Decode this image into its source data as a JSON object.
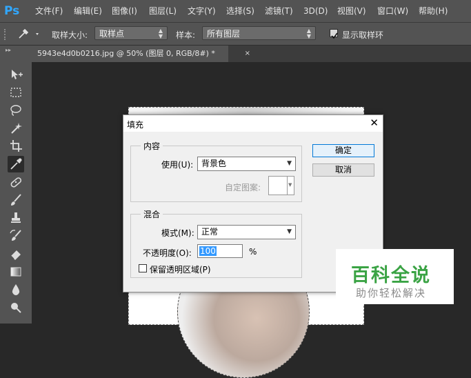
{
  "app": {
    "logo": "Ps"
  },
  "menu": [
    {
      "id": "file",
      "label": "文件(F)"
    },
    {
      "id": "edit",
      "label": "编辑(E)"
    },
    {
      "id": "image",
      "label": "图像(I)"
    },
    {
      "id": "layer",
      "label": "图层(L)"
    },
    {
      "id": "type",
      "label": "文字(Y)"
    },
    {
      "id": "select",
      "label": "选择(S)"
    },
    {
      "id": "filter",
      "label": "滤镜(T)"
    },
    {
      "id": "3d",
      "label": "3D(D)"
    },
    {
      "id": "view",
      "label": "视图(V)"
    },
    {
      "id": "window",
      "label": "窗口(W)"
    },
    {
      "id": "help",
      "label": "帮助(H)"
    }
  ],
  "options": {
    "sample_size_label": "取样大小:",
    "sample_size_value": "取样点",
    "sample_label": "样本:",
    "sample_value": "所有图层",
    "show_ring_label": "显示取样环",
    "show_ring_checked": true
  },
  "document_tab": {
    "title": "5943e4d0b0216.jpg @ 50% (图层 0, RGB/8#) *",
    "close": "×"
  },
  "toolbar": {
    "head": "▸▸",
    "tools": [
      {
        "id": "move",
        "icon": "move-icon"
      },
      {
        "id": "marquee",
        "icon": "rect-marquee-icon"
      },
      {
        "id": "lasso",
        "icon": "lasso-icon"
      },
      {
        "id": "magic-wand",
        "icon": "magic-wand-icon"
      },
      {
        "id": "crop",
        "icon": "crop-icon"
      },
      {
        "id": "eyedropper",
        "icon": "eyedropper-icon",
        "active": true
      },
      {
        "id": "healing",
        "icon": "healing-brush-icon"
      },
      {
        "id": "brush",
        "icon": "brush-icon"
      },
      {
        "id": "stamp",
        "icon": "clone-stamp-icon"
      },
      {
        "id": "history-brush",
        "icon": "history-brush-icon"
      },
      {
        "id": "eraser",
        "icon": "eraser-icon"
      },
      {
        "id": "gradient",
        "icon": "gradient-icon"
      },
      {
        "id": "blur",
        "icon": "blur-icon"
      },
      {
        "id": "dodge",
        "icon": "dodge-icon"
      }
    ]
  },
  "dialog": {
    "title": "填充",
    "close": "✕",
    "contents": {
      "legend": "内容",
      "use_label": "使用(U):",
      "use_value": "背景色",
      "pattern_label": "自定图案:"
    },
    "blending": {
      "legend": "混合",
      "mode_label": "模式(M):",
      "mode_value": "正常",
      "opacity_label": "不透明度(O):",
      "opacity_value": "100",
      "opacity_unit": "%",
      "preserve_label": "保留透明区域(P)",
      "preserve_checked": false
    },
    "ok_label": "确定",
    "cancel_label": "取消"
  },
  "watermark": {
    "title": "百科全说",
    "subtitle": "助你轻松解决"
  },
  "colors": {
    "ps_blue": "#31a8ff",
    "watermark_green": "#3aa344",
    "dialog_default_border": "#0078d7"
  }
}
